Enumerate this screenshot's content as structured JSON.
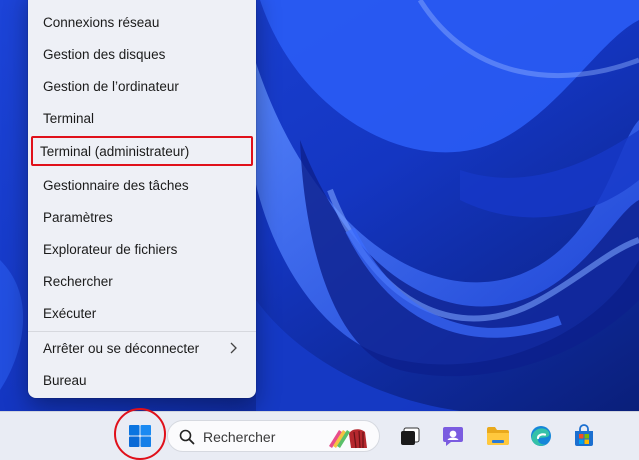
{
  "menu": {
    "items": [
      {
        "label": "Connexions réseau"
      },
      {
        "label": "Gestion des disques"
      },
      {
        "label": "Gestion de l’ordinateur"
      },
      {
        "label": "Terminal"
      },
      {
        "label": "Terminal (administrateur)"
      },
      {
        "label": "Gestionnaire des tâches"
      },
      {
        "label": "Paramètres"
      },
      {
        "label": "Explorateur de fichiers"
      },
      {
        "label": "Rechercher"
      },
      {
        "label": "Exécuter"
      },
      {
        "label": "Arrêter ou se déconnecter"
      },
      {
        "label": "Bureau"
      }
    ],
    "highlighted_item": "Terminal (administrateur)",
    "highlight_color": "#e0101a"
  },
  "taskbar": {
    "search_placeholder": "Rechercher",
    "icons": [
      "start-icon",
      "search-icon",
      "search-highlight-icon",
      "task-view-icon",
      "teams-chat-icon",
      "file-explorer-icon",
      "edge-icon",
      "microsoft-store-icon"
    ]
  },
  "colors": {
    "wallpaper": "#1a3fd0",
    "menu_background": "#eef0f6",
    "taskbar_background": "#e9ecf4",
    "accent": "#0067c0"
  }
}
